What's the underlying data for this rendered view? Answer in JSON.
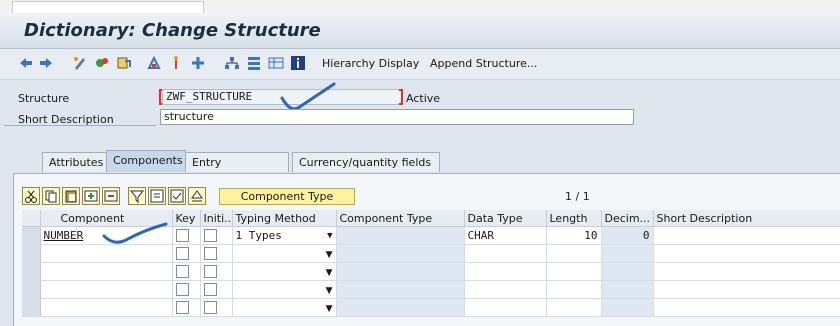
{
  "window": {
    "title": "Dictionary: Change Structure"
  },
  "toolbar": {
    "icons": [
      "back-arrow-icon",
      "forward-arrow-icon",
      "display-change-icon",
      "other-object-icon",
      "activate-icon",
      "where-used-icon",
      "navigation-icon",
      "object-list-icon",
      "hierarchy-icon",
      "documentation-icon",
      "info-icon"
    ],
    "hierarchy_display": "Hierarchy Display",
    "append_structure": "Append Structure..."
  },
  "form": {
    "structure_label": "Structure",
    "structure_value": "ZWF_STRUCTURE",
    "status": "Active",
    "short_desc_label": "Short Description",
    "short_desc_value": "structure"
  },
  "tabs": [
    {
      "label": "Attributes",
      "active": false
    },
    {
      "label": "Components",
      "active": true
    },
    {
      "label": "Entry help/check",
      "active": false
    },
    {
      "label": "Currency/quantity fields",
      "active": false
    }
  ],
  "grid": {
    "component_type_button": "Component Type",
    "pager": "1  /  1",
    "columns": [
      "Component",
      "Key",
      "Initi...",
      "Typing Method",
      "Component Type",
      "Data Type",
      "Length",
      "Decim...",
      "Short Description"
    ],
    "rows": [
      {
        "component": "NUMBER",
        "typing": "1 Types",
        "comptype": "",
        "datatype": "CHAR",
        "length": "10",
        "decimals": "0",
        "desc": ""
      },
      {
        "component": "",
        "typing": "",
        "comptype": "",
        "datatype": "",
        "length": "",
        "decimals": "",
        "desc": ""
      },
      {
        "component": "",
        "typing": "",
        "comptype": "",
        "datatype": "",
        "length": "",
        "decimals": "",
        "desc": ""
      },
      {
        "component": "",
        "typing": "",
        "comptype": "",
        "datatype": "",
        "length": "",
        "decimals": "",
        "desc": ""
      },
      {
        "component": "",
        "typing": "",
        "comptype": "",
        "datatype": "",
        "length": "",
        "decimals": "",
        "desc": ""
      }
    ]
  },
  "colors": {
    "accent_check": "#2a64c8",
    "required_marker": "#e03020",
    "button_yellow": "#fff3a0"
  }
}
